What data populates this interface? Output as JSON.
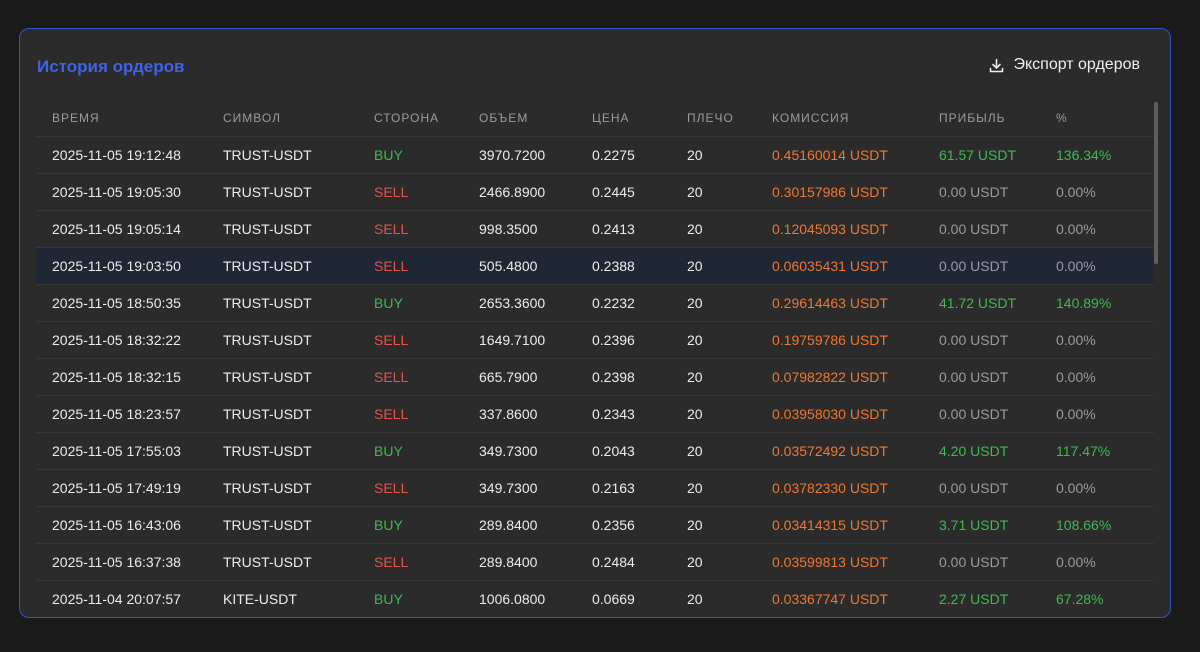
{
  "panel": {
    "title": "История ордеров",
    "export_label": "Экспорт ордеров",
    "export_icon": "download-icon"
  },
  "colors": {
    "accent": "#3f62e6",
    "buy": "#3fb950",
    "sell": "#e5534b",
    "fee": "#f0772f",
    "muted": "#9a9aa0"
  },
  "table": {
    "columns": [
      "ВРЕМЯ",
      "СИМВОЛ",
      "СТОРОНА",
      "ОБЪЕМ",
      "ЦЕНА",
      "ПЛЕЧО",
      "КОМИССИЯ",
      "ПРИБЫЛЬ",
      "%"
    ],
    "rows": [
      {
        "time": "2025-11-05 19:12:48",
        "symbol": "TRUST-USDT",
        "side": "BUY",
        "volume": "3970.7200",
        "price": "0.2275",
        "leverage": "20",
        "fee": "0.45160014 USDT",
        "profit": "61.57 USDT",
        "percent": "136.34%"
      },
      {
        "time": "2025-11-05 19:05:30",
        "symbol": "TRUST-USDT",
        "side": "SELL",
        "volume": "2466.8900",
        "price": "0.2445",
        "leverage": "20",
        "fee": "0.30157986 USDT",
        "profit": "0.00 USDT",
        "percent": "0.00%"
      },
      {
        "time": "2025-11-05 19:05:14",
        "symbol": "TRUST-USDT",
        "side": "SELL",
        "volume": "998.3500",
        "price": "0.2413",
        "leverage": "20",
        "fee": "0.12045093 USDT",
        "profit": "0.00 USDT",
        "percent": "0.00%"
      },
      {
        "time": "2025-11-05 19:03:50",
        "symbol": "TRUST-USDT",
        "side": "SELL",
        "volume": "505.4800",
        "price": "0.2388",
        "leverage": "20",
        "fee": "0.06035431 USDT",
        "profit": "0.00 USDT",
        "percent": "0.00%",
        "highlighted": true
      },
      {
        "time": "2025-11-05 18:50:35",
        "symbol": "TRUST-USDT",
        "side": "BUY",
        "volume": "2653.3600",
        "price": "0.2232",
        "leverage": "20",
        "fee": "0.29614463 USDT",
        "profit": "41.72 USDT",
        "percent": "140.89%"
      },
      {
        "time": "2025-11-05 18:32:22",
        "symbol": "TRUST-USDT",
        "side": "SELL",
        "volume": "1649.7100",
        "price": "0.2396",
        "leverage": "20",
        "fee": "0.19759786 USDT",
        "profit": "0.00 USDT",
        "percent": "0.00%"
      },
      {
        "time": "2025-11-05 18:32:15",
        "symbol": "TRUST-USDT",
        "side": "SELL",
        "volume": "665.7900",
        "price": "0.2398",
        "leverage": "20",
        "fee": "0.07982822 USDT",
        "profit": "0.00 USDT",
        "percent": "0.00%"
      },
      {
        "time": "2025-11-05 18:23:57",
        "symbol": "TRUST-USDT",
        "side": "SELL",
        "volume": "337.8600",
        "price": "0.2343",
        "leverage": "20",
        "fee": "0.03958030 USDT",
        "profit": "0.00 USDT",
        "percent": "0.00%"
      },
      {
        "time": "2025-11-05 17:55:03",
        "symbol": "TRUST-USDT",
        "side": "BUY",
        "volume": "349.7300",
        "price": "0.2043",
        "leverage": "20",
        "fee": "0.03572492 USDT",
        "profit": "4.20 USDT",
        "percent": "117.47%"
      },
      {
        "time": "2025-11-05 17:49:19",
        "symbol": "TRUST-USDT",
        "side": "SELL",
        "volume": "349.7300",
        "price": "0.2163",
        "leverage": "20",
        "fee": "0.03782330 USDT",
        "profit": "0.00 USDT",
        "percent": "0.00%"
      },
      {
        "time": "2025-11-05 16:43:06",
        "symbol": "TRUST-USDT",
        "side": "BUY",
        "volume": "289.8400",
        "price": "0.2356",
        "leverage": "20",
        "fee": "0.03414315 USDT",
        "profit": "3.71 USDT",
        "percent": "108.66%"
      },
      {
        "time": "2025-11-05 16:37:38",
        "symbol": "TRUST-USDT",
        "side": "SELL",
        "volume": "289.8400",
        "price": "0.2484",
        "leverage": "20",
        "fee": "0.03599813 USDT",
        "profit": "0.00 USDT",
        "percent": "0.00%"
      },
      {
        "time": "2025-11-04 20:07:57",
        "symbol": "KITE-USDT",
        "side": "BUY",
        "volume": "1006.0800",
        "price": "0.0669",
        "leverage": "20",
        "fee": "0.03367747 USDT",
        "profit": "2.27 USDT",
        "percent": "67.28%"
      }
    ]
  }
}
